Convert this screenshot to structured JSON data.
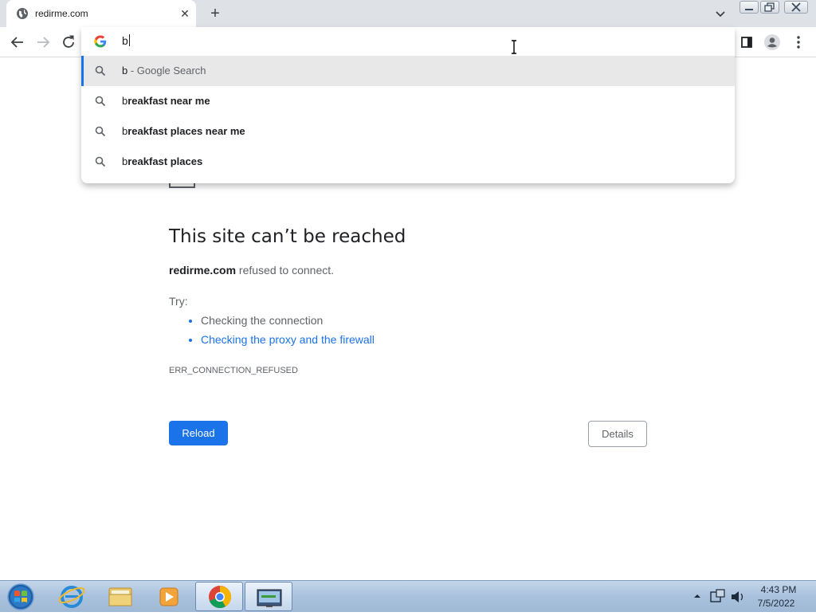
{
  "browser": {
    "tab": {
      "title": "redirme.com"
    },
    "omnibox": {
      "input_value": "b",
      "suggestions": [
        {
          "typed": "b",
          "completion": "",
          "description": " - Google Search",
          "selected": true
        },
        {
          "typed": "b",
          "completion": "reakfast near me",
          "description": "",
          "selected": false
        },
        {
          "typed": "b",
          "completion": "reakfast places near me",
          "description": "",
          "selected": false
        },
        {
          "typed": "b",
          "completion": "reakfast places",
          "description": "",
          "selected": false
        }
      ]
    }
  },
  "error_page": {
    "title": "This site can’t be reached",
    "host": "redirme.com",
    "message": " refused to connect.",
    "try_label": "Try:",
    "suggestions": [
      "Checking the connection",
      "Checking the proxy and the firewall"
    ],
    "error_code": "ERR_CONNECTION_REFUSED",
    "reload_label": "Reload",
    "details_label": "Details"
  },
  "taskbar": {
    "items": [
      "start-orb",
      "internet-explorer",
      "file-explorer",
      "media-player",
      "chrome",
      "remote-desktop"
    ],
    "time": "4:43 PM",
    "date": "7/5/2022"
  },
  "colors": {
    "accent": "#1a73e8",
    "tab_strip": "#dee1e6"
  }
}
